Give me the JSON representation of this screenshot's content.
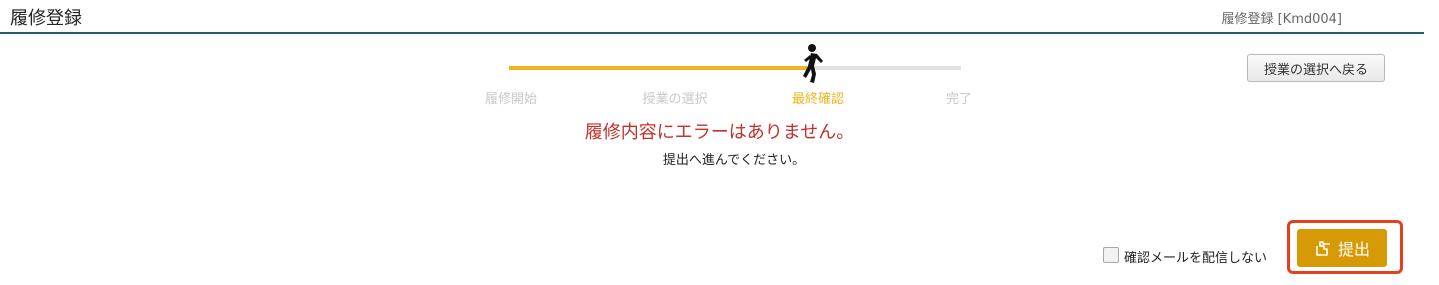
{
  "header": {
    "title": "履修登録",
    "screen_id": "履修登録 [Kmd004]"
  },
  "actions": {
    "back_label": "授業の選択へ戻る",
    "submit_label": "提出",
    "submit_icon": "hand-point-icon"
  },
  "progress": {
    "steps": [
      {
        "label": "履修開始",
        "state": "done"
      },
      {
        "label": "授業の選択",
        "state": "done"
      },
      {
        "label": "最終確認",
        "state": "current"
      },
      {
        "label": "完了",
        "state": "pending"
      }
    ],
    "current_index": 2,
    "completed_fraction": 0.66,
    "runner_icon": "running-person-icon",
    "colors": {
      "active": "#efb521",
      "inactive": "#e3e3e3"
    }
  },
  "message": {
    "main": "履修内容にエラーはありません。",
    "sub": "提出へ進んでください。"
  },
  "mail": {
    "label": "確認メールを配信しない",
    "checked": false
  },
  "colors": {
    "accent": "#1f5f6b",
    "error": "#c0332c",
    "submit": "#d69a07",
    "highlight": "#e4401c"
  }
}
